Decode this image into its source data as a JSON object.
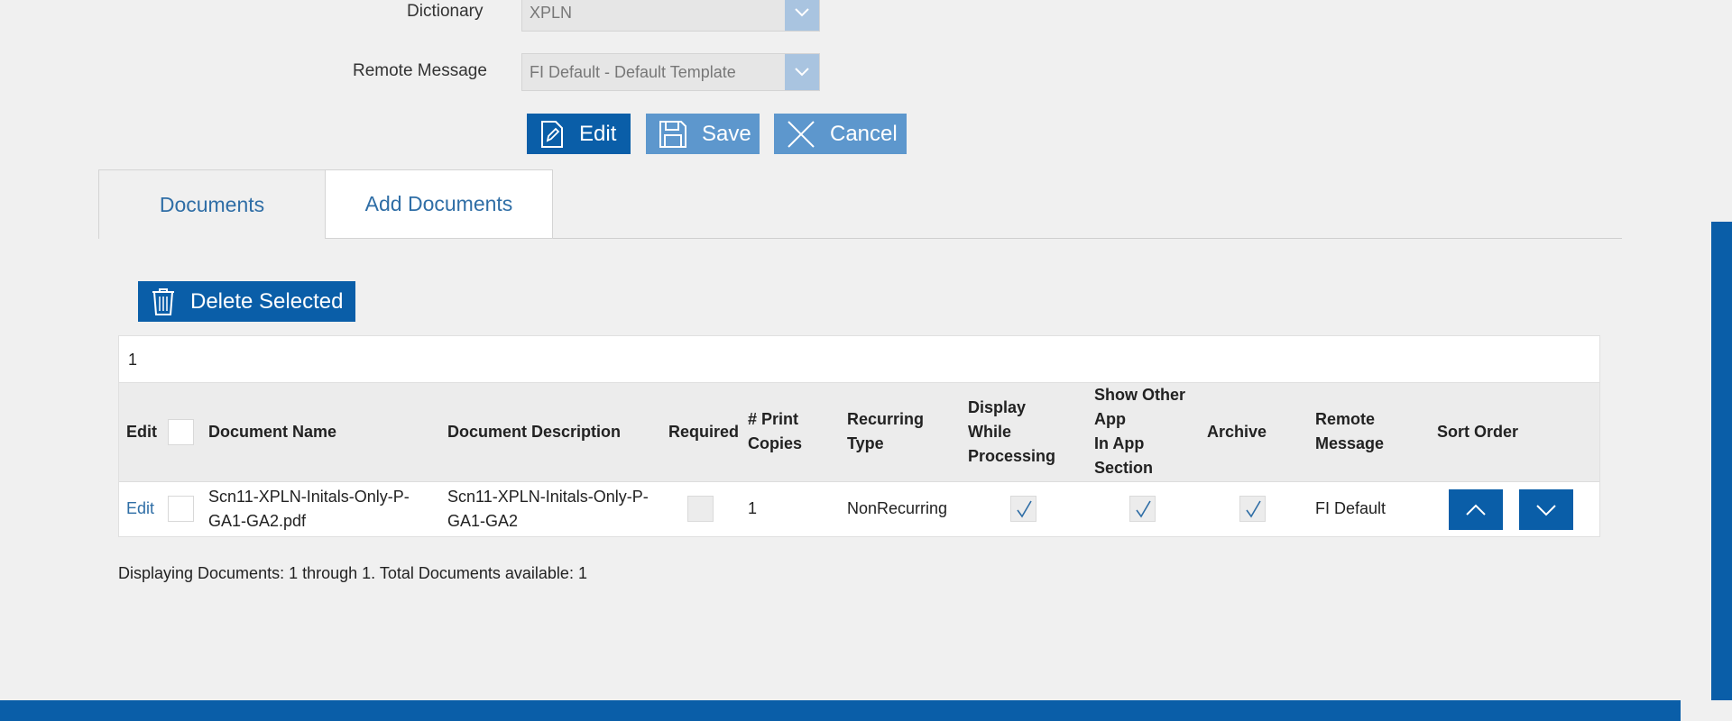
{
  "form": {
    "dictionary_label": "Dictionary",
    "dictionary_value": "XPLN",
    "remote_message_label": "Remote Message",
    "remote_message_value": "FI Default - Default Template"
  },
  "actions": {
    "edit_label": "Edit",
    "save_label": "Save",
    "cancel_label": "Cancel"
  },
  "tabs": [
    {
      "label": "Documents"
    },
    {
      "label": "Add Documents"
    }
  ],
  "toolbar": {
    "delete_selected_label": "Delete Selected"
  },
  "grid": {
    "page_number": "1",
    "headers": {
      "edit": "Edit",
      "document_name": "Document Name",
      "document_description": "Document Description",
      "required": "Required",
      "print_copies_l1": "# Print",
      "print_copies_l2": "Copies",
      "recurring_type_l1": "Recurring",
      "recurring_type_l2": "Type",
      "display_l1": "Display",
      "display_l2": "While",
      "display_l3": "Processing",
      "show_other_l1": "Show Other",
      "show_other_l2": "App",
      "show_other_l3": "In App",
      "show_other_l4": "Section",
      "archive": "Archive",
      "remote_message_l1": "Remote",
      "remote_message_l2": "Message",
      "sort_order": "Sort Order"
    },
    "rows": [
      {
        "edit_link": "Edit",
        "name_l1": "Scn11-XPLN-Initals-Only-P-",
        "name_l2": "GA1-GA2.pdf",
        "desc_l1": "Scn11-XPLN-Initals-Only-P-",
        "desc_l2": "GA1-GA2",
        "required": false,
        "print_copies": "1",
        "recurring_type": "NonRecurring",
        "display_while_processing": true,
        "show_other_app": true,
        "archive": true,
        "remote_message": "FI Default"
      }
    ]
  },
  "footer": {
    "summary": "Displaying Documents: 1 through 1. Total Documents available: 1"
  },
  "colors": {
    "primary": "#0a5ea8",
    "primary_light": "#5d97cd",
    "link": "#2f6ea6",
    "background": "#f0f0f0"
  },
  "icons": [
    "chevron-down-icon",
    "edit-icon",
    "save-icon",
    "close-icon",
    "trash-icon",
    "check-icon",
    "chevron-up-icon"
  ]
}
